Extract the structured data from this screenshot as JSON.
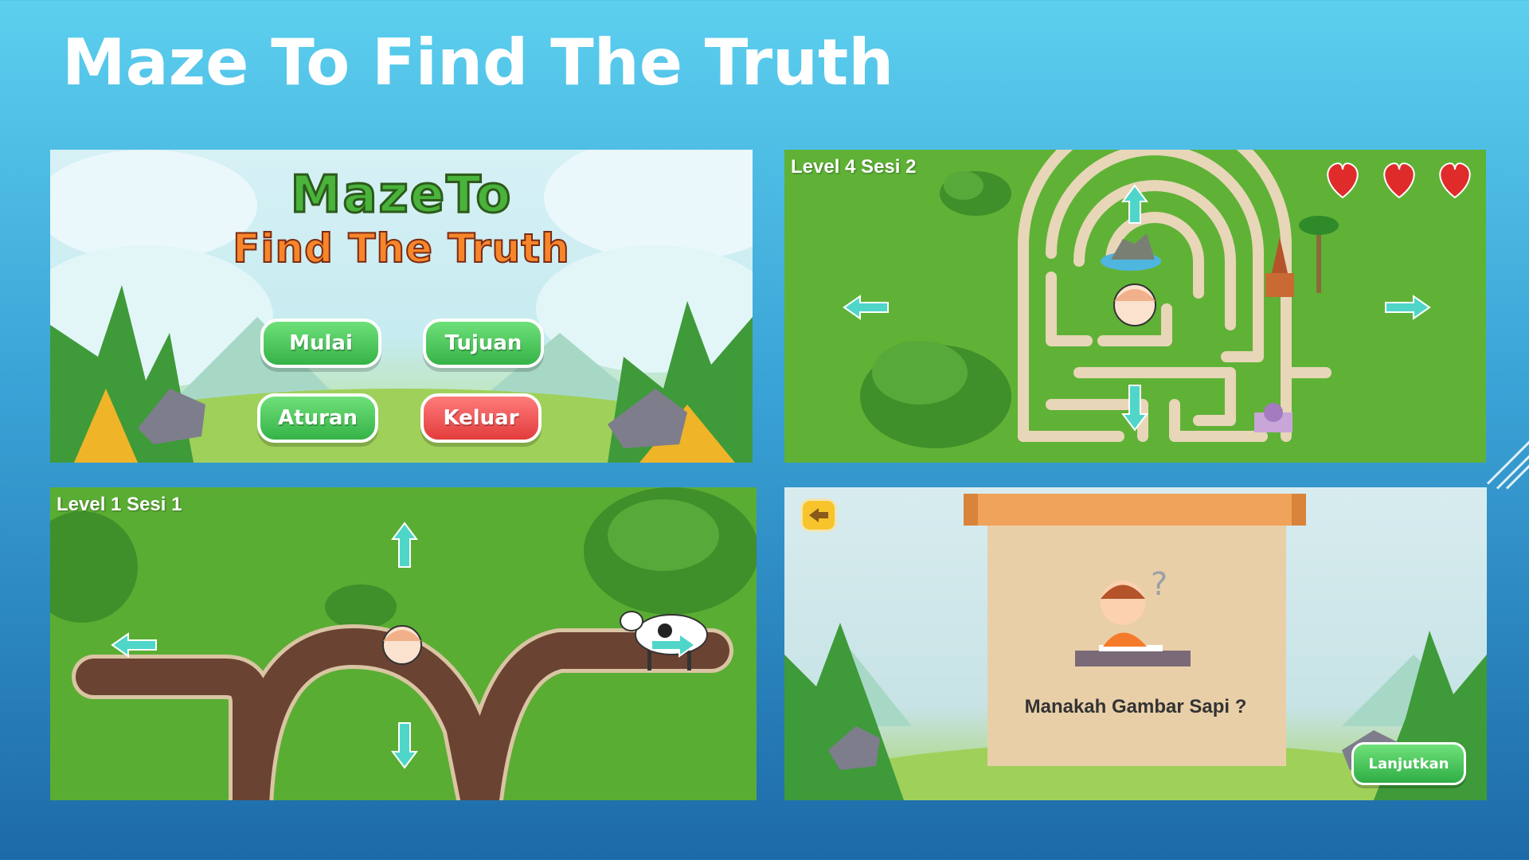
{
  "slide": {
    "title": "Maze To Find The Truth"
  },
  "menu_screen": {
    "logo_line1": "MazeTo",
    "logo_line2": "Find The Truth",
    "buttons": {
      "start": "Mulai",
      "goal": "Tujuan",
      "rules": "Aturan",
      "exit": "Keluar"
    }
  },
  "level4_screen": {
    "label": "Level 4 Sesi 2",
    "lives": 3,
    "icons": [
      "heart-icon",
      "arrow-up-icon",
      "arrow-down-icon",
      "arrow-left-icon",
      "arrow-right-icon",
      "temple-icon",
      "mosque-icon",
      "palm-tree-icon",
      "rock-pond-icon"
    ]
  },
  "level1_screen": {
    "label": "Level 1 Sesi 1",
    "icons": [
      "arrow-up-icon",
      "arrow-down-icon",
      "arrow-left-icon",
      "arrow-right-icon",
      "cow-icon"
    ]
  },
  "quiz_screen": {
    "question": "Manakah Gambar Sapi ?",
    "continue_label": "Lanjutkan"
  },
  "colors": {
    "accent_green": "#35b347",
    "exit_red": "#e23c3c",
    "arrow_teal": "#4fd6c9",
    "path_brown": "#6b4332",
    "maze_path": "#e8d6b8",
    "scroll_orange": "#f0a35a"
  }
}
